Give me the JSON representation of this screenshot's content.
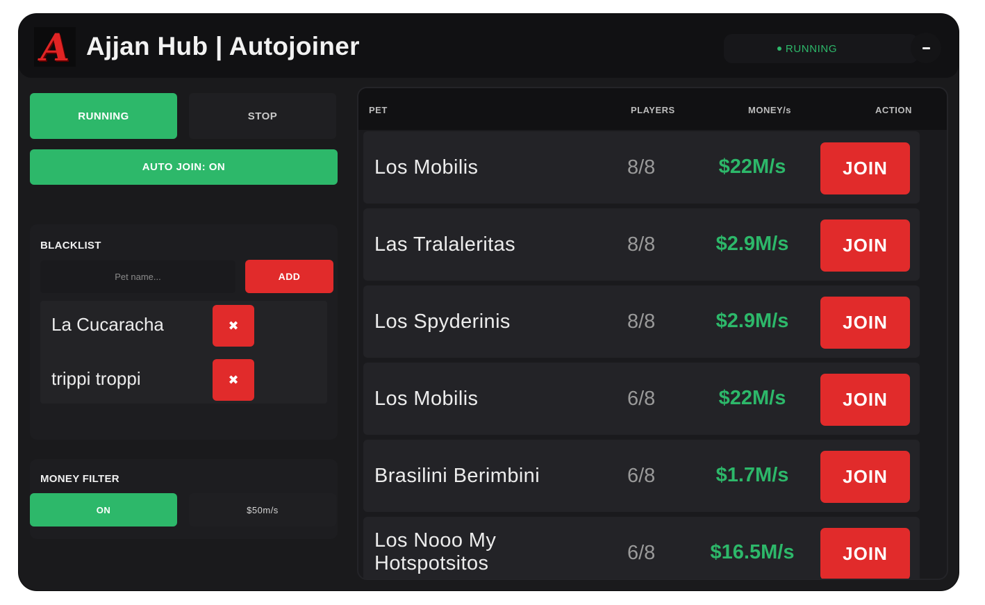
{
  "header": {
    "logo_letter": "A",
    "title": "Ajjan Hub | Autojoiner",
    "status": "RUNNING",
    "minimize_label": "–"
  },
  "controls": {
    "running_label": "RUNNING",
    "stop_label": "STOP",
    "auto_join_label": "AUTO JOIN: ON"
  },
  "blacklist": {
    "title": "BLACKLIST",
    "input_placeholder": "Pet name...",
    "add_label": "ADD",
    "remove_symbol": "✖",
    "items": [
      "La Cucaracha",
      "trippi troppi"
    ]
  },
  "money_filter": {
    "title": "MONEY FILTER",
    "toggle_label": "ON",
    "threshold": "$50m/s"
  },
  "table": {
    "columns": [
      "PET",
      "PLAYERS",
      "MONEY/s",
      "ACTION"
    ],
    "join_label": "JOIN",
    "rows": [
      {
        "pet": "Los Mobilis",
        "players": "8/8",
        "money": "$22M/s"
      },
      {
        "pet": "Las Tralaleritas",
        "players": "8/8",
        "money": "$2.9M/s"
      },
      {
        "pet": "Los Spyderinis",
        "players": "8/8",
        "money": "$2.9M/s"
      },
      {
        "pet": "Los Mobilis",
        "players": "6/8",
        "money": "$22M/s"
      },
      {
        "pet": "Brasilini Berimbini",
        "players": "6/8",
        "money": "$1.7M/s"
      },
      {
        "pet": "Los Nooo My Hotspotsitos",
        "players": "6/8",
        "money": "$16.5M/s"
      }
    ]
  },
  "colors": {
    "accent_green": "#2db86a",
    "accent_red": "#e12b2b",
    "background": "#1a1a1c"
  }
}
